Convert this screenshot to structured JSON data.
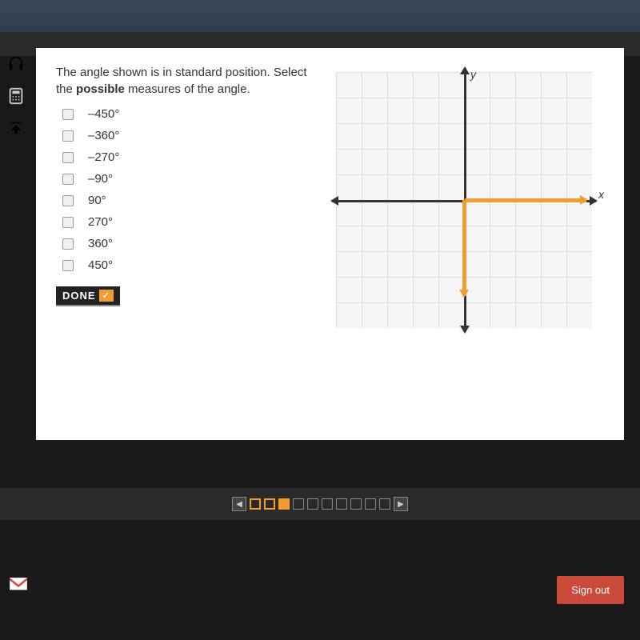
{
  "question": {
    "text_part1": "The angle shown is in standard position. Select the ",
    "text_bold": "possible",
    "text_part2": " measures of the angle."
  },
  "options": [
    {
      "label": "–450°",
      "checked": false
    },
    {
      "label": "–360°",
      "checked": false
    },
    {
      "label": "–270°",
      "checked": false
    },
    {
      "label": "–90°",
      "checked": false
    },
    {
      "label": "90°",
      "checked": false
    },
    {
      "label": "270°",
      "checked": false
    },
    {
      "label": "360°",
      "checked": false
    },
    {
      "label": "450°",
      "checked": false
    }
  ],
  "done_button": "DONE",
  "graph": {
    "x_label": "x",
    "y_label": "y"
  },
  "signout": "Sign out",
  "chart_data": {
    "type": "angle-plot",
    "description": "Coordinate grid showing an angle in standard position",
    "initial_side": "positive x-axis",
    "terminal_side": "negative y-axis",
    "grid_extent": 5,
    "axes": [
      "x",
      "y"
    ],
    "angle_candidates_deg": [
      -450,
      -90,
      270
    ]
  },
  "progress": {
    "total": 10,
    "states": [
      "outline",
      "outline",
      "current",
      "empty",
      "empty",
      "empty",
      "empty",
      "empty",
      "empty",
      "empty"
    ]
  }
}
